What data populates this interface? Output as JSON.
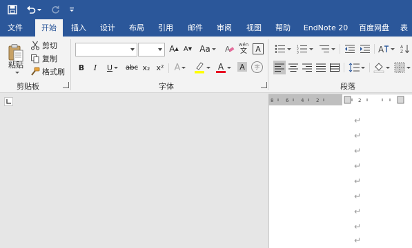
{
  "quick_access": {
    "save_icon": "save-icon",
    "undo_icon": "undo-icon",
    "redo_icon": "redo-icon",
    "customize_icon": "customize-qat-icon"
  },
  "tabs": [
    {
      "label": "文件"
    },
    {
      "label": "开始",
      "active": true
    },
    {
      "label": "插入"
    },
    {
      "label": "设计"
    },
    {
      "label": "布局"
    },
    {
      "label": "引用"
    },
    {
      "label": "邮件"
    },
    {
      "label": "审阅"
    },
    {
      "label": "视图"
    },
    {
      "label": "帮助"
    },
    {
      "label": "EndNote 20"
    },
    {
      "label": "百度网盘"
    },
    {
      "label": "表"
    }
  ],
  "clipboard": {
    "group_label": "剪贴板",
    "paste_label": "粘贴",
    "cut_label": "剪切",
    "copy_label": "复制",
    "format_painter_label": "格式刷"
  },
  "font": {
    "group_label": "字体",
    "font_name_value": "",
    "font_size_value": "",
    "grow_label": "A",
    "shrink_label": "A",
    "case_label": "Aa",
    "phonetic_top": "wén",
    "phonetic_bottom": "文",
    "border_label": "A",
    "bold": "B",
    "italic": "I",
    "underline": "U",
    "strike": "abc",
    "subscript": "x₂",
    "superscript": "x²",
    "effects": "A",
    "font_color": "A",
    "shading": "A",
    "enclose": "字"
  },
  "paragraph": {
    "group_label": "段落"
  },
  "document": {
    "paragraph_mark": "↵",
    "marks_count": 9
  },
  "colors": {
    "title_bar": "#2b579a",
    "ribbon_bg": "#f3f3f3",
    "highlight_yellow": "#ffff00",
    "font_red": "#e81123"
  }
}
